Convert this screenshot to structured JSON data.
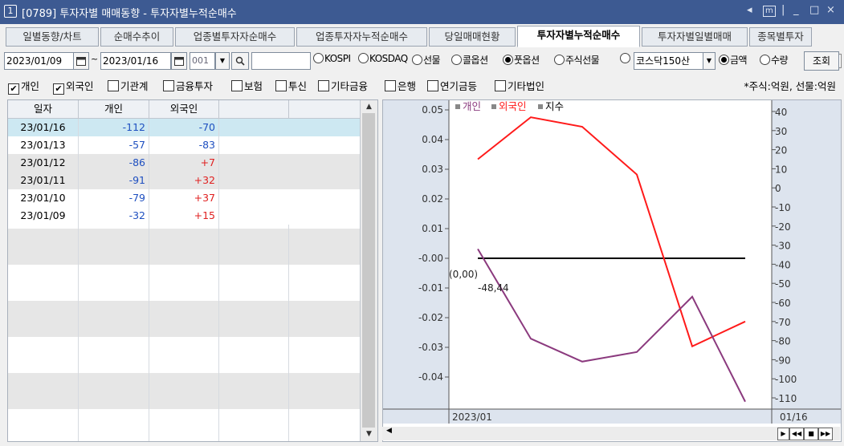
{
  "window": {
    "number": "1",
    "title": "[0789] 투자자별 매매동향 - 투자자별누적순매수",
    "controls": [
      "◂",
      "m",
      "|",
      "_",
      "□",
      "×"
    ]
  },
  "tabs": [
    {
      "label": "일별동향/차트",
      "active": false
    },
    {
      "label": "순매수추이",
      "active": false
    },
    {
      "label": "업종별투자자순매수",
      "active": false
    },
    {
      "label": "업종투자자누적순매수",
      "active": false
    },
    {
      "label": "당일매매현황",
      "active": false
    },
    {
      "label": "투자자별누적순매수",
      "active": true
    },
    {
      "label": "투자자별일별매매",
      "active": false
    },
    {
      "label": "종목별투자",
      "active": false
    }
  ],
  "tab_nav": "◀▶",
  "query": {
    "date_from": "2023/01/09",
    "tilde": "~",
    "date_to": "2023/01/16",
    "code": "001",
    "input": "",
    "market_options": [
      {
        "label": "KOSPI",
        "selected": false
      },
      {
        "label": "KOSDAQ",
        "selected": false
      },
      {
        "label": "선물",
        "selected": false
      },
      {
        "label": "콜옵션",
        "selected": false
      },
      {
        "label": "풋옵션",
        "selected": true
      },
      {
        "label": "주식선물",
        "selected": false
      }
    ],
    "index_select": "코스닥150산",
    "value_options": [
      {
        "label": "금액",
        "selected": true
      },
      {
        "label": "수량",
        "selected": false
      }
    ],
    "search_button": "조회"
  },
  "investors": [
    {
      "label": "개인",
      "checked": true
    },
    {
      "label": "외국인",
      "checked": true
    },
    {
      "label": "기관계",
      "checked": false
    },
    {
      "label": "금융투자",
      "checked": false
    },
    {
      "label": "보험",
      "checked": false
    },
    {
      "label": "투신",
      "checked": false
    },
    {
      "label": "기타금융",
      "checked": false
    },
    {
      "label": "은행",
      "checked": false
    },
    {
      "label": "연기금등",
      "checked": false
    },
    {
      "label": "기타법인",
      "checked": false
    }
  ],
  "unit_note": "*주식:억원, 선물:억원",
  "table": {
    "headers": [
      "일자",
      "개인",
      "외국인"
    ],
    "rows": [
      {
        "date": "23/01/16",
        "individual": "-112",
        "foreign": "-70",
        "selected": true
      },
      {
        "date": "23/01/13",
        "individual": "-57",
        "foreign": "-83",
        "selected": false
      },
      {
        "date": "23/01/12",
        "individual": "-86",
        "foreign": "+7",
        "selected": false
      },
      {
        "date": "23/01/11",
        "individual": "-91",
        "foreign": "+32",
        "selected": false
      },
      {
        "date": "23/01/10",
        "individual": "-79",
        "foreign": "+37",
        "selected": false
      },
      {
        "date": "23/01/09",
        "individual": "-32",
        "foreign": "+15",
        "selected": false
      }
    ]
  },
  "chart_data": {
    "type": "line",
    "legend": [
      "개인",
      "외국인",
      "지수"
    ],
    "colors": {
      "개인": "#8b3a7e",
      "외국인": "#ff1a1a",
      "지수": "#000000"
    },
    "x": [
      "2023/01/09",
      "2023/01/10",
      "2023/01/11",
      "2023/01/12",
      "2023/01/13",
      "2023/01/16"
    ],
    "series": [
      {
        "name": "개인",
        "axis": "right",
        "values": [
          -32,
          -79,
          -91,
          -86,
          -57,
          -112
        ]
      },
      {
        "name": "외국인",
        "axis": "right",
        "values": [
          15,
          37,
          32,
          7,
          -83,
          -70
        ]
      },
      {
        "name": "지수",
        "axis": "left",
        "values": [
          0.0,
          0.0,
          0.0,
          0.0,
          0.0,
          0.0
        ]
      }
    ],
    "left_ylim": [
      -0.04,
      0.05
    ],
    "left_ticks": [
      "0.05",
      "0.04",
      "0.03",
      "0.02",
      "0.01",
      "-0.00",
      "-0.01",
      "-0.02",
      "-0.03",
      "-0.04"
    ],
    "right_ylim": [
      -110,
      40
    ],
    "right_ticks": [
      "40",
      "30",
      "20",
      "10",
      "0",
      "-10",
      "-20",
      "-30",
      "-40",
      "-50",
      "-60",
      "-70",
      "-80",
      "-90",
      "-100",
      "-110"
    ],
    "annotation_point": "(0,00)",
    "annotation_value": "-48,44",
    "x_start_label": "2023/01",
    "x_end_label": "01/16"
  }
}
